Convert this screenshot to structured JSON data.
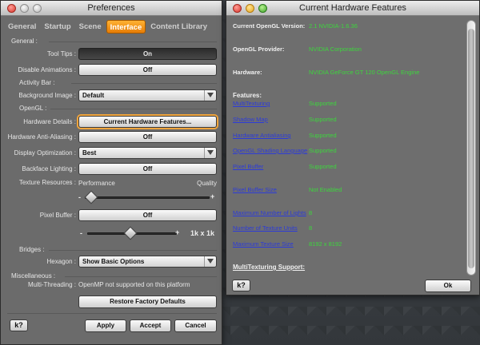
{
  "prefs": {
    "title": "Preferences",
    "tabs": [
      "General",
      "Startup",
      "Scene",
      "Interface",
      "Content Library"
    ],
    "active_tab": "Interface",
    "sections": {
      "general": "General :",
      "activity_bar": "Activity Bar :",
      "opengl": "OpenGL :",
      "bridges": "Bridges :",
      "misc": "Miscellaneous :"
    },
    "rows": {
      "tooltips": {
        "label": "Tool Tips :",
        "value": "On"
      },
      "disable_anim": {
        "label": "Disable Animations :",
        "value": "Off"
      },
      "bg_image": {
        "label": "Background Image :",
        "value": "Default"
      },
      "hw_details": {
        "label": "Hardware Details :",
        "value": "Current Hardware Features..."
      },
      "hw_aa": {
        "label": "Hardware Anti-Aliasing :",
        "value": "Off"
      },
      "display_opt": {
        "label": "Display Optimization :",
        "value": "Best"
      },
      "backface": {
        "label": "Backface Lighting :",
        "value": "Off"
      },
      "tex_res": {
        "label": "Texture Resources :",
        "min": "Performance",
        "max": "Quality",
        "minus": "-",
        "plus": "+",
        "level": 0.05
      },
      "pixel_buffer": {
        "label": "Pixel Buffer :",
        "value": "Off"
      },
      "pb_slider": {
        "minus": "-",
        "plus": "+",
        "level": 0.48,
        "size_text": "1k x 1k"
      },
      "hexagon": {
        "label": "Hexagon :",
        "value": "Show Basic Options"
      },
      "multithreading": {
        "label": "Multi-Threading :",
        "value": "OpenMP not supported on this platform"
      }
    },
    "restore_label": "Restore Factory Defaults",
    "help_label": "k?",
    "buttons": {
      "apply": "Apply",
      "accept": "Accept",
      "cancel": "Cancel"
    }
  },
  "hw": {
    "title": "Current Hardware Features",
    "info": [
      {
        "k": "Current OpenGL Version:",
        "v": "2.1 NVIDIA-1.6.36"
      },
      {
        "k": "OpenGL Provider:",
        "v": "NVIDIA Corporation"
      },
      {
        "k": "Hardware:",
        "v": "NVIDIA GeForce GT 120 OpenGL Engine"
      }
    ],
    "features_heading": "Features:",
    "features": [
      {
        "k": "MultiTexturing",
        "v": "Supported"
      },
      {
        "k": "Shadow Map",
        "v": "Supported"
      },
      {
        "k": "Hardware Antialiasing",
        "v": "Supported"
      },
      {
        "k": "OpenGL Shading Language",
        "v": "Supported"
      },
      {
        "k": "Pixel Buffer",
        "v": "Supported"
      },
      {
        "k": "Pixel Buffer Size",
        "v": "Not Enabled"
      },
      {
        "k": "Maximum Number of Lights",
        "v": "8"
      },
      {
        "k": "Number of Texture Units",
        "v": "8"
      },
      {
        "k": "Maximum Texture Size",
        "v": "8192 x 8192"
      }
    ],
    "multitex_heading": "MultiTexturing Support:",
    "help_label": "k?",
    "ok_label": "Ok"
  },
  "colors": {
    "accent": "#f0a030",
    "supported": "#3dd63d",
    "link": "#2c3bd9"
  }
}
